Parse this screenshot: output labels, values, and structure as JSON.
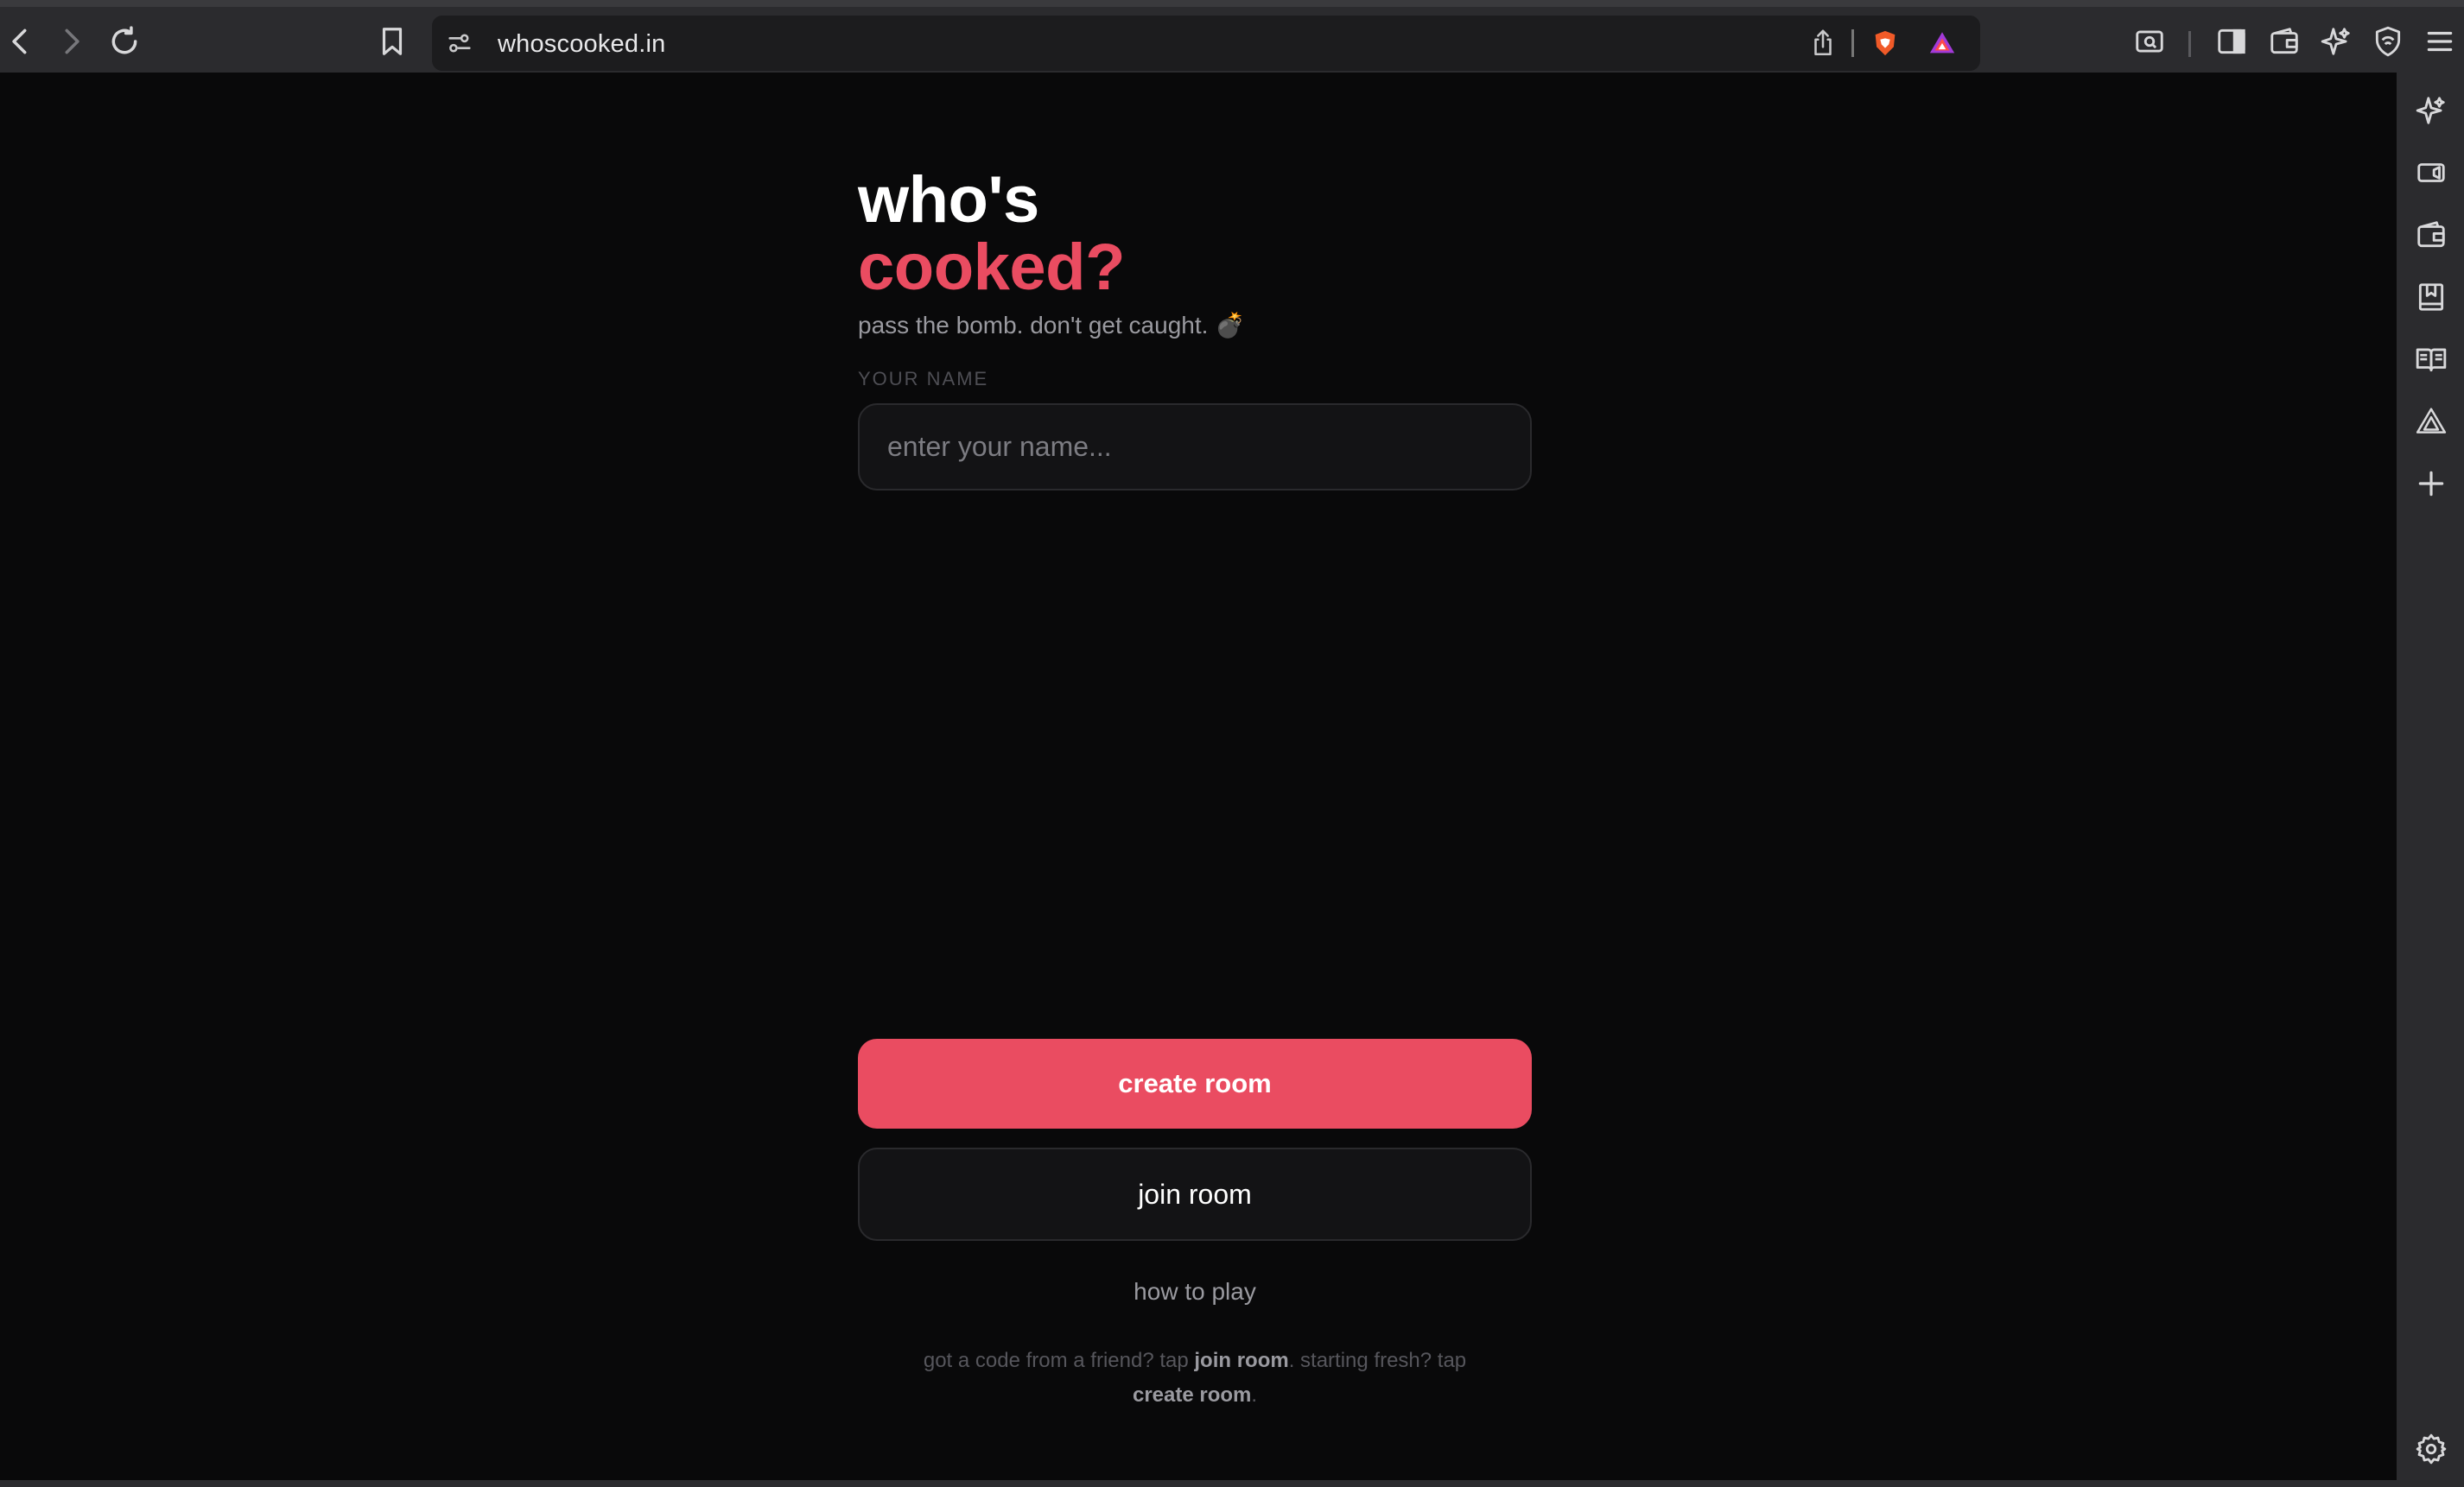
{
  "browser": {
    "url": "whoscooked.in"
  },
  "page": {
    "title_line1": "who's",
    "title_line2": "cooked?",
    "tagline": "pass the bomb. don't get caught. 💣",
    "name_label": "YOUR NAME",
    "name_placeholder": "enter your name...",
    "create_button": "create room",
    "join_button": "join room",
    "how_to_play": "how to play",
    "hint": {
      "part1": "got a code from a friend? tap ",
      "bold1": "join room",
      "part2": ". starting fresh? tap ",
      "bold2": "create room",
      "part3": "."
    }
  },
  "colors": {
    "accent": "#ea4c61",
    "background": "#09090a",
    "input_bg": "#131315"
  }
}
